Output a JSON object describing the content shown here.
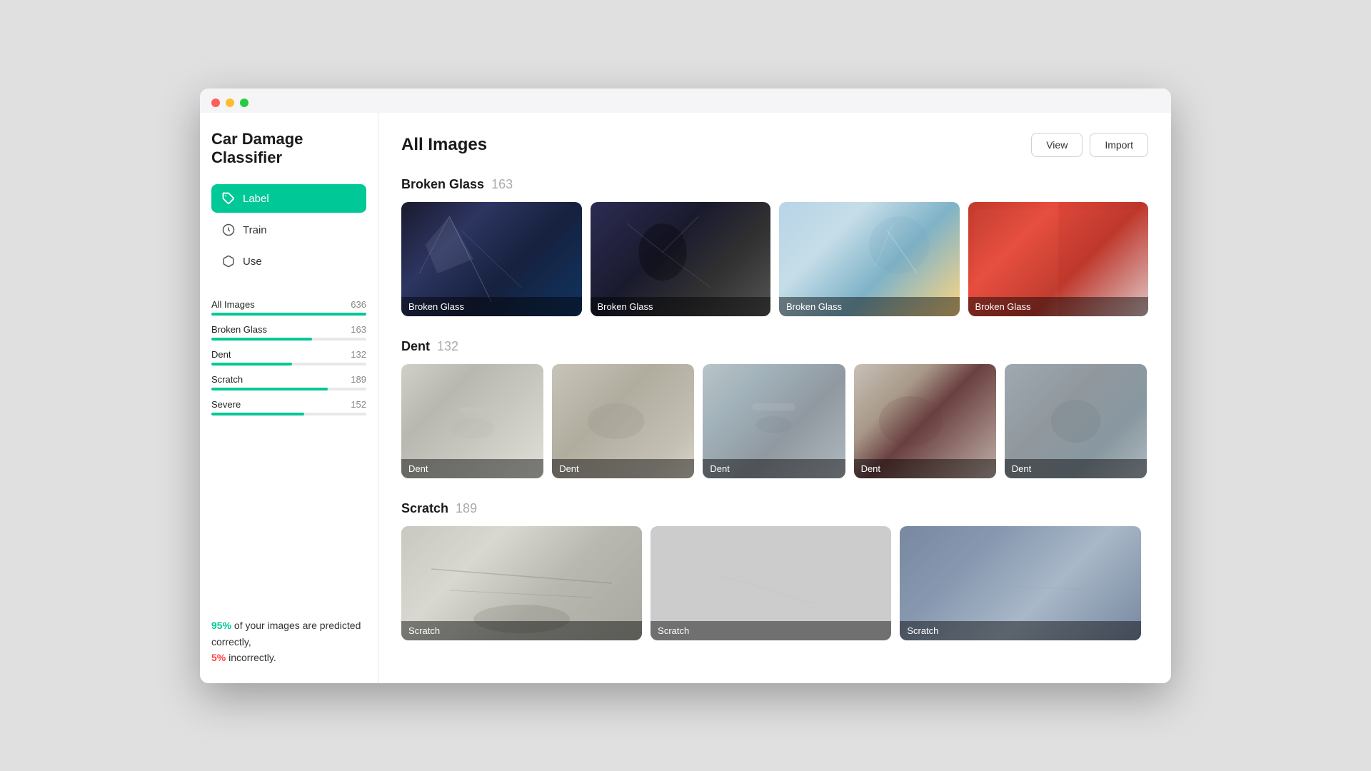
{
  "window": {
    "title": "Car Damage Classifier"
  },
  "sidebar": {
    "app_title": "Car Damage Classifier",
    "nav": [
      {
        "id": "label",
        "label": "Label",
        "icon": "label-icon",
        "active": true
      },
      {
        "id": "train",
        "label": "Train",
        "icon": "train-icon",
        "active": false
      },
      {
        "id": "use",
        "label": "Use",
        "icon": "use-icon",
        "active": false
      }
    ],
    "categories": [
      {
        "name": "All Images",
        "count": 636,
        "pct": 100
      },
      {
        "name": "Broken Glass",
        "count": 163,
        "pct": 65
      },
      {
        "name": "Dent",
        "count": 132,
        "pct": 52
      },
      {
        "name": "Scratch",
        "count": 189,
        "pct": 75
      },
      {
        "name": "Severe",
        "count": 152,
        "pct": 60
      }
    ],
    "stats": {
      "correct_pct": "95%",
      "incorrect_pct": "5%",
      "text_before": "of your images are predicted correctly,",
      "text_after": "incorrectly."
    }
  },
  "main": {
    "title": "All Images",
    "buttons": {
      "view": "View",
      "import": "Import"
    },
    "sections": [
      {
        "id": "broken-glass",
        "title": "Broken Glass",
        "count": 163,
        "images": [
          {
            "label": "Broken Glass",
            "style_class": "bg-img-1"
          },
          {
            "label": "Broken Glass",
            "style_class": "bg-img-2"
          },
          {
            "label": "Broken Glass",
            "style_class": "bg-img-3"
          },
          {
            "label": "Broken Glass",
            "style_class": "bg-img-4"
          }
        ]
      },
      {
        "id": "dent",
        "title": "Dent",
        "count": 132,
        "images": [
          {
            "label": "Dent",
            "style_class": "dent-img-1"
          },
          {
            "label": "Dent",
            "style_class": "dent-img-2"
          },
          {
            "label": "Dent",
            "style_class": "dent-img-3"
          },
          {
            "label": "Dent",
            "style_class": "dent-img-4"
          },
          {
            "label": "Dent",
            "style_class": "dent-img-5"
          }
        ]
      },
      {
        "id": "scratch",
        "title": "Scratch",
        "count": 189,
        "images": [
          {
            "label": "Scratch",
            "style_class": "scratch-img-1"
          },
          {
            "label": "Scratch",
            "style_class": "scratch-img-2"
          },
          {
            "label": "Scratch",
            "style_class": "scratch-img-3"
          }
        ]
      }
    ]
  },
  "colors": {
    "accent": "#00c896",
    "correct": "#00c896",
    "incorrect": "#ff4444"
  }
}
